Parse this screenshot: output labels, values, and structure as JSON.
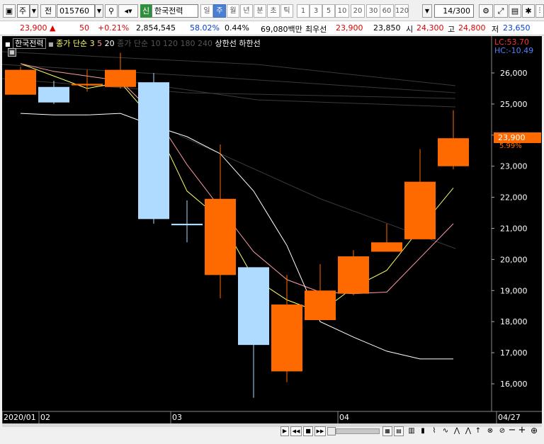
{
  "toolbar": {
    "market_type": "주",
    "prev_label": "전",
    "stock_code": "015760",
    "stock_badge": "신",
    "stock_name": "한국전력",
    "periods": [
      "일",
      "주",
      "월",
      "년",
      "분",
      "초",
      "틱"
    ],
    "active_period": "주",
    "intervals": [
      "1",
      "3",
      "5",
      "10",
      "20",
      "30",
      "60",
      "120"
    ],
    "page_counter": "14/300"
  },
  "quote": {
    "price": "23,900",
    "change_arrow": "▲",
    "change": "50",
    "change_pct": "+0.21%",
    "volume": "2,854,545",
    "volume_ratio": "58.02%",
    "turnover": "0.44%",
    "amount": "69,080백만",
    "priority_label": "최우선",
    "ask": "23,900",
    "bid": "23,850",
    "open_label": "시",
    "open": "24,300",
    "high_label": "고",
    "high": "24,800",
    "low_label": "저",
    "low": "23,650"
  },
  "legend": {
    "name": "한국전력",
    "ma_label": "종가 단순",
    "ma_periods": [
      "3",
      "5",
      "20"
    ],
    "ma_hidden": "종가 단순 10 120 180 240",
    "upper_limit": "상한선",
    "lower_limit": "하한선"
  },
  "axis_info": {
    "lc": "LC:53.70",
    "hc": "HC:-10.49",
    "current_price": "23,900",
    "current_pct": "5.99%"
  },
  "colors": {
    "up": "#ff6a00",
    "down": "#aedbff",
    "ma3": "#ffff66",
    "ma5": "#ff9aa2",
    "ma20": "#ffffff",
    "axis_text": "#ffffff",
    "lc_text": "#ff3030",
    "hc_text": "#5080ff"
  },
  "chart_data": {
    "type": "candlestick",
    "ylim": [
      15500,
      26600
    ],
    "yticks": [
      26000,
      25000,
      24000,
      23000,
      22000,
      21000,
      20000,
      19000,
      18000,
      17000,
      16000
    ],
    "xlabels": [
      "2020/01",
      "02",
      "03",
      "04",
      "04/27"
    ],
    "candles": [
      {
        "o": 25300,
        "h": 26200,
        "l": 25300,
        "c": 26100
      },
      {
        "o": 25550,
        "h": 25750,
        "l": 25000,
        "c": 25050
      },
      {
        "o": 25600,
        "h": 26100,
        "l": 25400,
        "c": 25650
      },
      {
        "o": 25550,
        "h": 26650,
        "l": 25500,
        "c": 26100
      },
      {
        "o": 25700,
        "h": 26000,
        "l": 21150,
        "c": 21300
      },
      {
        "o": 21150,
        "h": 21900,
        "l": 20550,
        "c": 21100
      },
      {
        "o": 19500,
        "h": 23700,
        "l": 18750,
        "c": 21950
      },
      {
        "o": 19750,
        "h": 19750,
        "l": 15550,
        "c": 17250
      },
      {
        "o": 16400,
        "h": 19500,
        "l": 16050,
        "c": 18550
      },
      {
        "o": 18050,
        "h": 19850,
        "l": 18050,
        "c": 19000
      },
      {
        "o": 18900,
        "h": 20300,
        "l": 18850,
        "c": 20100
      },
      {
        "o": 20250,
        "h": 21150,
        "l": 20250,
        "c": 20550
      },
      {
        "o": 20650,
        "h": 23550,
        "l": 20650,
        "c": 22500
      },
      {
        "o": 23000,
        "h": 24800,
        "l": 22900,
        "c": 23900
      }
    ],
    "series": [
      {
        "name": "3",
        "values": [
          26300,
          25900,
          25500,
          25700,
          24450,
          22200,
          21300,
          19400,
          18700,
          18300,
          19100,
          19650,
          21000,
          22300
        ]
      },
      {
        "name": "5",
        "values": [
          26300,
          26050,
          25900,
          25750,
          24700,
          23050,
          21650,
          20250,
          19350,
          18950,
          18900,
          18950,
          20050,
          21150
        ]
      },
      {
        "name": "20",
        "values": [
          24700,
          24650,
          24650,
          24700,
          24300,
          23950,
          23400,
          22200,
          20450,
          18000,
          17500,
          17050,
          16800,
          16800
        ]
      }
    ]
  },
  "bottom": {
    "nav_play": "▶",
    "nav_first": "◀◀",
    "nav_stop": "■",
    "nav_last": "▶▶"
  }
}
